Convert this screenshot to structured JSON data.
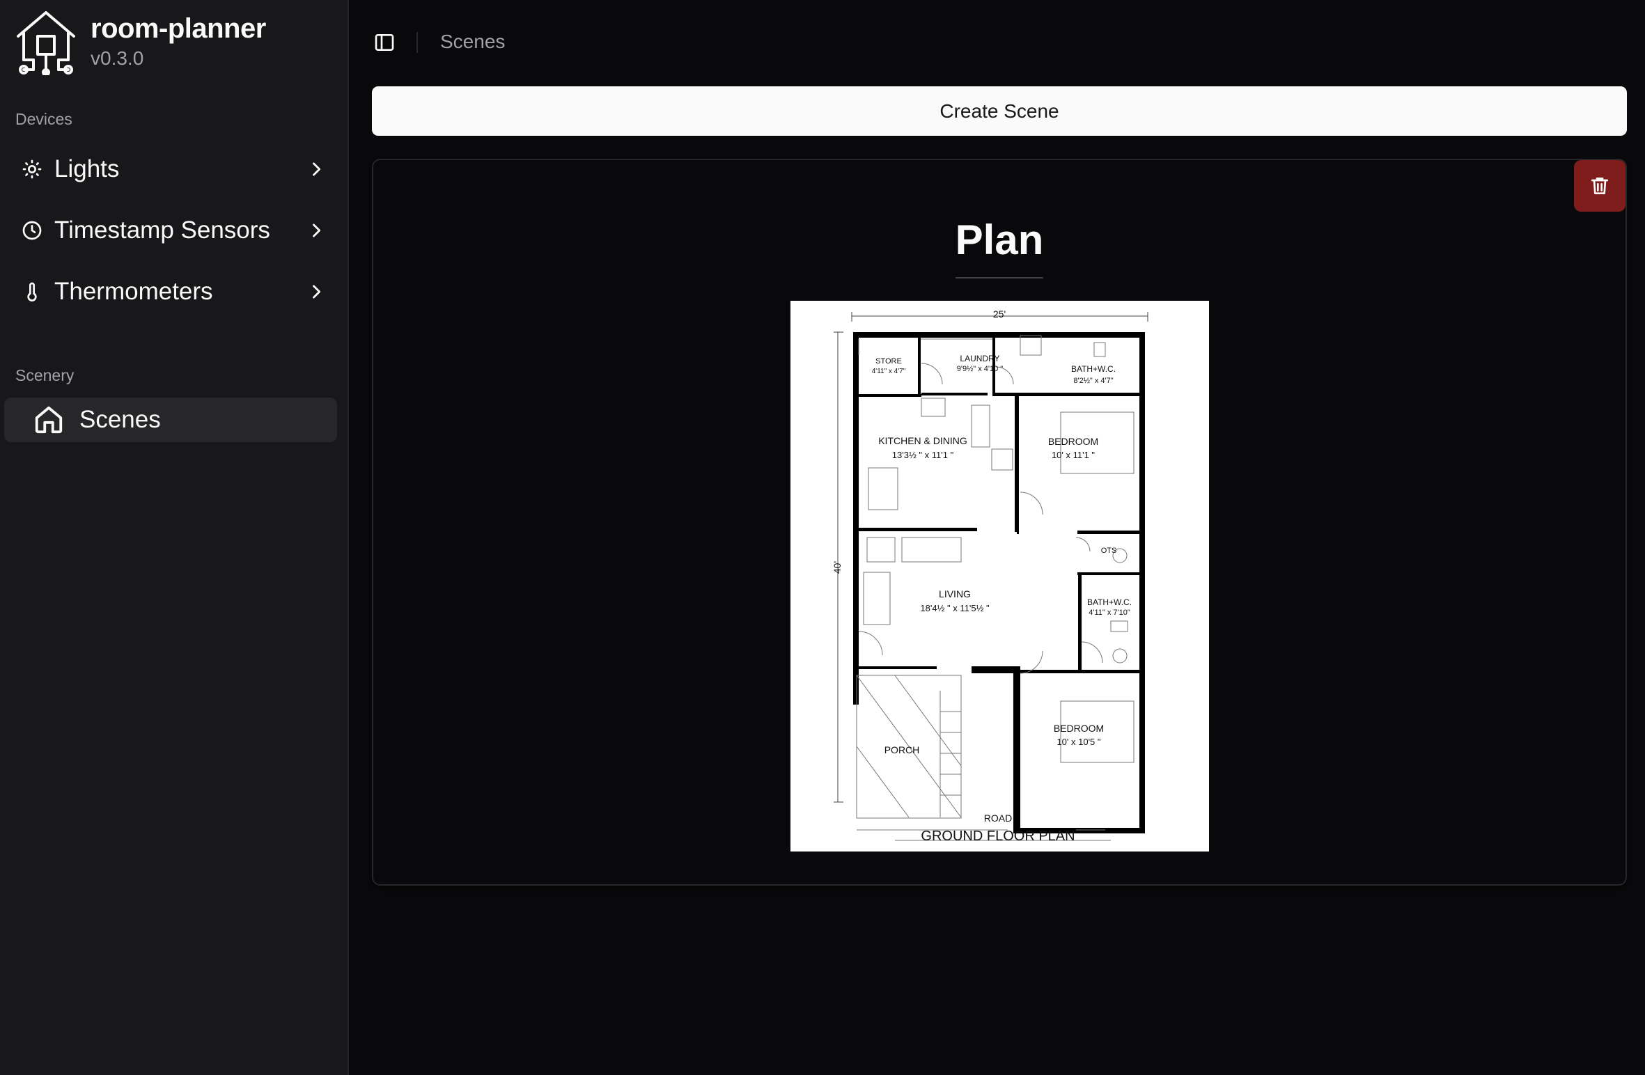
{
  "app": {
    "name": "room-planner",
    "version": "v0.3.0"
  },
  "sidebar": {
    "devices_label": "Devices",
    "devices": [
      {
        "label": "Lights",
        "icon": "sun-icon"
      },
      {
        "label": "Timestamp Sensors",
        "icon": "clock-icon"
      },
      {
        "label": "Thermometers",
        "icon": "thermometer-icon"
      }
    ],
    "scenery_label": "Scenery",
    "scenery": [
      {
        "label": "Scenes",
        "icon": "home-icon",
        "active": true
      }
    ]
  },
  "header": {
    "breadcrumb": "Scenes",
    "toggle_icon": "sidebar-toggle-icon"
  },
  "toolbar": {
    "create_label": "Create Scene"
  },
  "scene": {
    "title": "Plan",
    "delete_icon": "trash-icon",
    "image": {
      "dims": {
        "width": "25'",
        "depth": "40'"
      },
      "rooms": {
        "store": {
          "name": "STORE",
          "size": "4'11\" x 4'7\""
        },
        "laundry": {
          "name": "LAUNDRY",
          "size": "9'9½\" x 4'10 \""
        },
        "bath1": {
          "name": "BATH+W.C.",
          "size": "8'2½\" x 4'7\""
        },
        "kitchen": {
          "name": "KITCHEN & DINING",
          "size": "13'3½ \" x 11'1 \""
        },
        "bedroom1": {
          "name": "BEDROOM",
          "size": "10' x 11'1 \""
        },
        "ots": {
          "name": "OTS"
        },
        "living": {
          "name": "LIVING",
          "size": "18'4½ \" x 11'5½ \""
        },
        "bath2": {
          "name": "BATH+W.C.",
          "size": "4'11\" x 7'10\""
        },
        "bedroom2": {
          "name": "BEDROOM",
          "size": "10' x 10'5 \""
        },
        "porch": {
          "name": "PORCH"
        }
      },
      "road": "ROAD",
      "caption": "GROUND FLOOR PLAN"
    }
  },
  "colors": {
    "sidebar_bg": "#18181b",
    "main_bg": "#09090b",
    "active_item": "#27272a",
    "destructive": "#7f1d1d",
    "primary_btn": "#fafafa"
  }
}
